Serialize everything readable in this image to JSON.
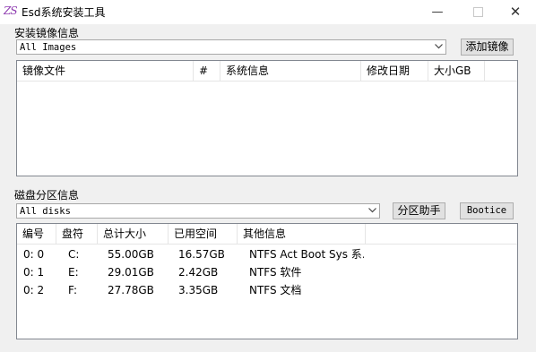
{
  "window": {
    "icon_text": "ZS",
    "title": "Esd系统安装工具",
    "minimize_glyph": "—",
    "close_glyph": "✕"
  },
  "image_section": {
    "label": "安装镜像信息",
    "combo_value": "All Images",
    "add_button": "添加镜像",
    "columns": [
      "镜像文件",
      "#",
      "系统信息",
      "修改日期",
      "大小GB"
    ],
    "rows": []
  },
  "disk_section": {
    "label": "磁盘分区信息",
    "combo_value": "All disks",
    "partition_button": "分区助手",
    "bootice_button": "Bootice",
    "columns": [
      "编号",
      "盘符",
      "总计大小",
      "已用空间",
      "其他信息"
    ],
    "rows": [
      {
        "id": "0: 0",
        "drive": "C:",
        "total": "55.00GB",
        "used": "16.57GB",
        "info": "NTFS Act Boot Sys 系…"
      },
      {
        "id": "0: 1",
        "drive": "E:",
        "total": "29.01GB",
        "used": "2.42GB",
        "info": "NTFS 软件"
      },
      {
        "id": "0: 2",
        "drive": "F:",
        "total": "27.78GB",
        "used": "3.35GB",
        "info": "NTFS 文档"
      }
    ]
  },
  "icons": {
    "app": "zs-logo-icon",
    "minimize": "minimize-icon",
    "maximize": "maximize-icon",
    "close": "close-icon",
    "dropdown": "chevron-down-icon"
  }
}
